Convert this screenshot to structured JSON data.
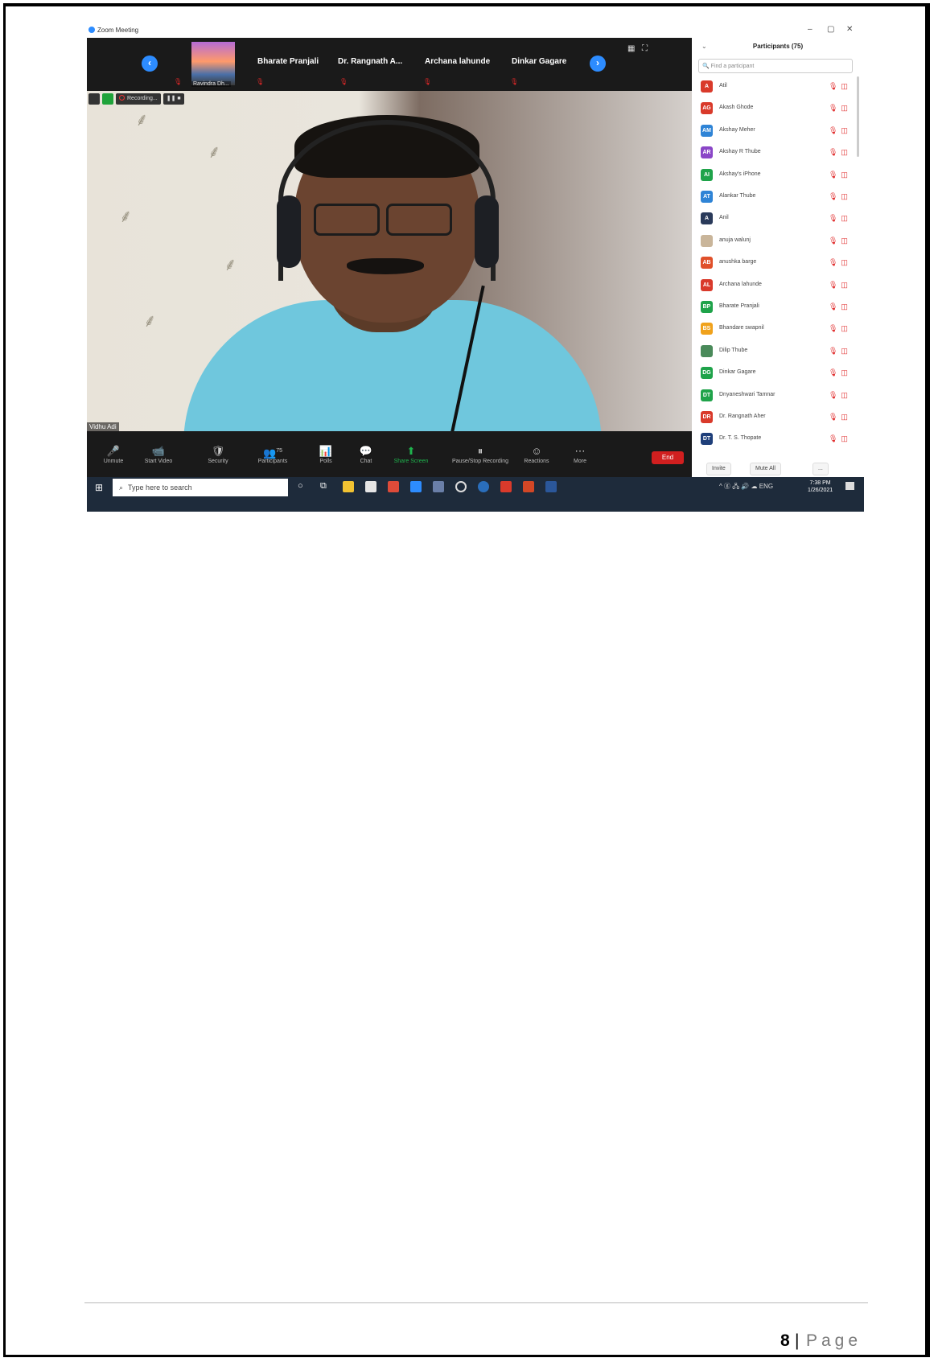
{
  "window": {
    "title": "Zoom Meeting",
    "controls": [
      "–",
      "▢",
      "✕"
    ]
  },
  "thumbnail_strip": {
    "thumb_caption": "Ravindra Dh...",
    "tiles": [
      "Bharate Pranjali",
      "Dr. Rangnath A...",
      "Archana lahunde",
      "Dinkar Gagare"
    ]
  },
  "video": {
    "recording_label": "Recording...",
    "speaker_name": "Vidhu Adi"
  },
  "toolbar": {
    "items": [
      {
        "icon": "🎤",
        "label": "Unmute"
      },
      {
        "icon": "📹",
        "label": "Start Video"
      },
      {
        "icon": "🛡",
        "label": "Security"
      },
      {
        "icon": "👥",
        "label": "Participants",
        "badge": "75"
      },
      {
        "icon": "📊",
        "label": "Polls"
      },
      {
        "icon": "💬",
        "label": "Chat"
      },
      {
        "icon": "⬆",
        "label": "Share Screen"
      },
      {
        "icon": "⏸",
        "label": "Pause/Stop Recording"
      },
      {
        "icon": "☺",
        "label": "Reactions"
      },
      {
        "icon": "⋯",
        "label": "More"
      }
    ],
    "end_label": "End"
  },
  "panel": {
    "title": "Participants (75)",
    "find_placeholder": "Find a participant",
    "participants": [
      {
        "initials": "A",
        "name": "Atil",
        "color": "#d93a2b"
      },
      {
        "initials": "AG",
        "name": "Akash Ghode",
        "color": "#d93a2b"
      },
      {
        "initials": "AM",
        "name": "Akshay Meher",
        "color": "#2f84d6"
      },
      {
        "initials": "AR",
        "name": "Akshay R Thube",
        "color": "#8a46c7"
      },
      {
        "initials": "AI",
        "name": "Akshay's iPhone",
        "color": "#1fa34a"
      },
      {
        "initials": "AT",
        "name": "Alankar Thube",
        "color": "#2f84d6"
      },
      {
        "initials": "A",
        "name": "Anil",
        "color": "#2a3a5a"
      },
      {
        "initials": "",
        "name": "anuja walunj",
        "color": "#c9b59a"
      },
      {
        "initials": "AB",
        "name": "anushka barge",
        "color": "#e0502a"
      },
      {
        "initials": "AL",
        "name": "Archana lahunde",
        "color": "#d93a2b"
      },
      {
        "initials": "BP",
        "name": "Bharate Pranjali",
        "color": "#1fa34a"
      },
      {
        "initials": "BS",
        "name": "Bhandare swapnil",
        "color": "#f0a21c"
      },
      {
        "initials": "",
        "name": "Dilip Thube",
        "color": "#4a8a5a"
      },
      {
        "initials": "DG",
        "name": "Dinkar Gagare",
        "color": "#1fa34a"
      },
      {
        "initials": "DT",
        "name": "Dnyaneshwari Tamnar",
        "color": "#1fa34a"
      },
      {
        "initials": "DR",
        "name": "Dr. Rangnath Aher",
        "color": "#d93a2b"
      },
      {
        "initials": "DT",
        "name": "Dr. T. S. Thopate",
        "color": "#1f3f7a"
      }
    ],
    "invite_label": "Invite",
    "mute_all_label": "Mute All",
    "more_label": "..."
  },
  "taskbar": {
    "search_placeholder": "Type here to search",
    "tray_text": "^ ⓖ 🖧 🔊 ☁ ENG",
    "time": "7:38 PM",
    "date": "1/26/2021"
  },
  "page_footer": {
    "number": "8",
    "separator": "|",
    "word": "Page"
  }
}
